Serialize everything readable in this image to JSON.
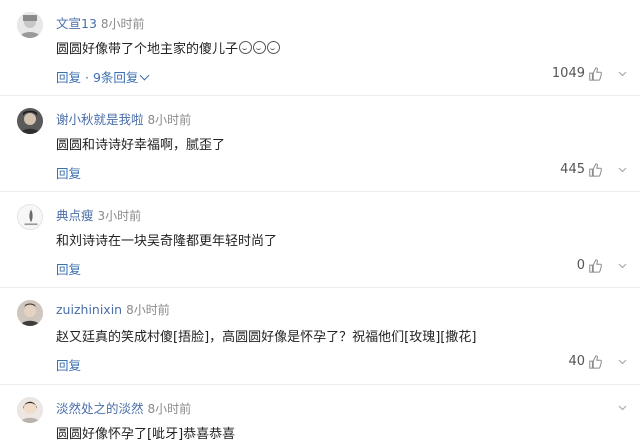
{
  "comments": [
    {
      "username": "文宣13",
      "time": "8小时前",
      "text": "圆圆好像带了个地主家的傻儿子",
      "emoji_count": 3,
      "reply_label": "回复",
      "replies_label": "9条回复",
      "likes": "1049"
    },
    {
      "username": "谢小秋就是我啦",
      "time": "8小时前",
      "text": "圆圆和诗诗好幸福啊，腻歪了",
      "reply_label": "回复",
      "likes": "445"
    },
    {
      "username": "典点瘦",
      "time": "3小时前",
      "text": "和刘诗诗在一块吴奇隆都更年轻时尚了",
      "reply_label": "回复",
      "likes": "0"
    },
    {
      "username": "zuizhinixin",
      "time": "8小时前",
      "text": "赵又廷真的笑成村傻[捂脸]，高圆圆好像是怀孕了？祝福他们[玫瑰][撒花]",
      "reply_label": "回复",
      "likes": "40"
    },
    {
      "username": "淡然处之的淡然",
      "time": "8小时前",
      "text": "圆圆好像怀孕了[呲牙]恭喜恭喜"
    }
  ],
  "colors": {
    "username": "#4a6ea9",
    "reply": "#3a6fb0",
    "text": "#222222",
    "muted": "#8a8a8a"
  },
  "icons": [
    "thumbs-up-icon",
    "chevron-down-icon",
    "emoji-icon"
  ]
}
